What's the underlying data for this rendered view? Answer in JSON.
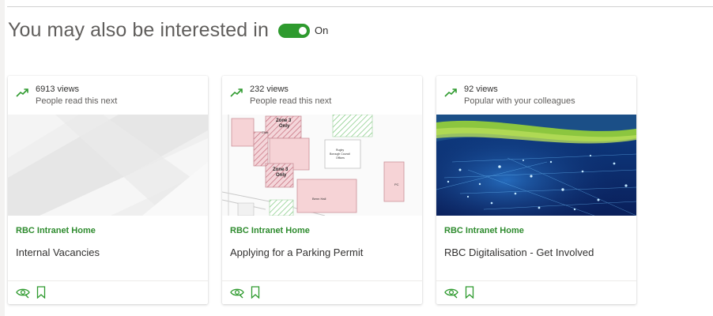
{
  "section": {
    "title": "You may also be interested in",
    "toggle_label": "On",
    "toggle_on": true,
    "accent_color": "#2e9a2e"
  },
  "cards": [
    {
      "views": "6913 views",
      "reason": "People read this next",
      "site": "RBC Intranet Home",
      "title": "Internal Vacancies",
      "icons": [
        "trending-up-icon",
        "views-eye-icon",
        "bookmark-icon"
      ]
    },
    {
      "views": "232 views",
      "reason": "People read this next",
      "site": "RBC Intranet Home",
      "title": "Applying for a Parking Permit",
      "thumbnail_text": [
        "Zone 3",
        "Only",
        "Zone 3",
        "Only",
        "Club",
        "Rugby",
        "Borough Council",
        "Offices",
        "Benn Hall",
        "PC"
      ],
      "icons": [
        "trending-up-icon",
        "views-eye-icon",
        "bookmark-icon"
      ]
    },
    {
      "views": "92 views",
      "reason": "Popular with your colleagues",
      "site": "RBC Intranet Home",
      "title": "RBC Digitalisation - Get Involved",
      "icons": [
        "trending-up-icon",
        "views-eye-icon",
        "bookmark-icon"
      ]
    }
  ]
}
